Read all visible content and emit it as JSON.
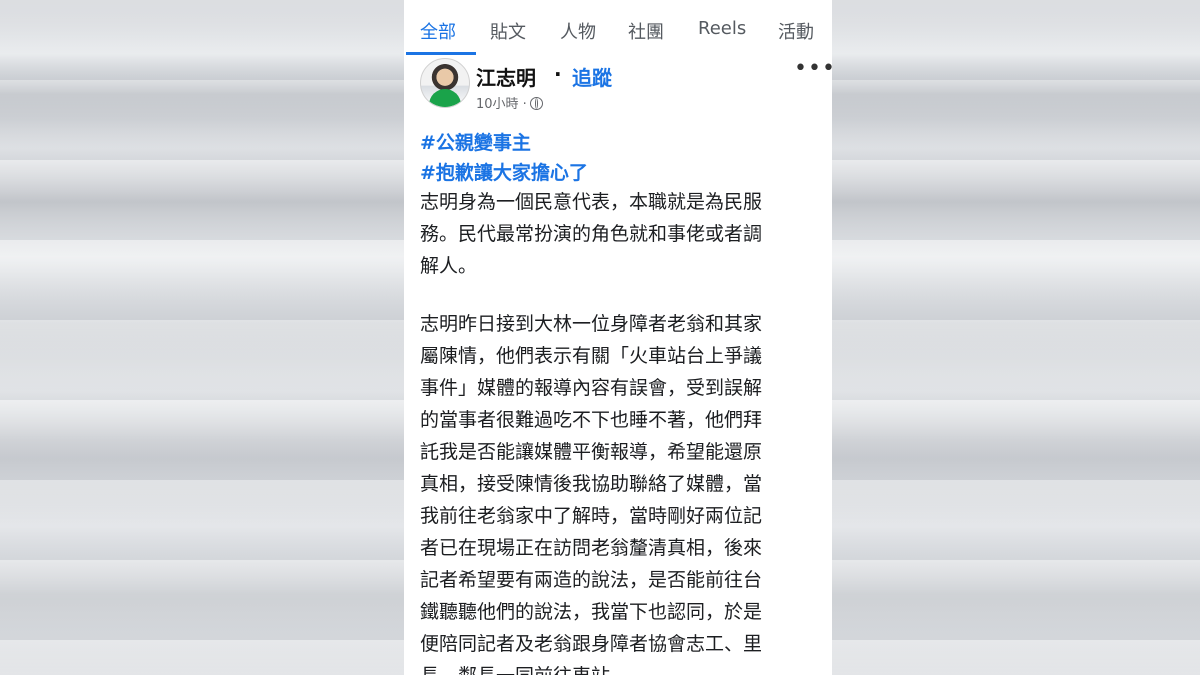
{
  "tabs": [
    "全部",
    "貼文",
    "人物",
    "社團",
    "Reels",
    "活動"
  ],
  "post": {
    "author": "江志明",
    "separator": "·",
    "follow_label": "追蹤",
    "time": "10小時 ·",
    "privacy_icon": "globe-icon",
    "more_icon": "more-options-icon",
    "hashtags": [
      "#公親變事主",
      "#抱歉讓大家擔心了"
    ],
    "paragraph1_lines": [
      "志明身為一個民意代表，本職就是為民服",
      "務。民代最常扮演的角色就和事佬或者調",
      "解人。"
    ],
    "paragraph2_lines": [
      "志明昨日接到大林一位身障者老翁和其家",
      "屬陳情，他們表示有關「火車站台上爭議",
      "事件」媒體的報導內容有誤會，受到誤解",
      "的當事者很難過吃不下也睡不著，他們拜",
      "託我是否能讓媒體平衡報導，希望能還原",
      "真相，接受陳情後我協助聯絡了媒體，當",
      "我前往老翁家中了解時，當時剛好兩位記",
      "者已在現場正在訪問老翁釐清真相，後來",
      "記者希望要有兩造的說法，是否能前往台",
      "鐵聽聽他們的說法，我當下也認同，於是",
      "便陪同記者及老翁跟身障者協會志工、里",
      "長、鄰長一同前往車站。"
    ]
  },
  "colors": {
    "accent": "#1b74e4",
    "text": "#1c1e21",
    "muted": "#65676b"
  }
}
